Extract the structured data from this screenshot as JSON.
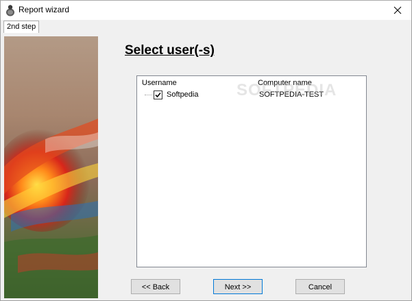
{
  "window": {
    "title": "Report wizard",
    "icon": "wizard-app-icon",
    "close_glyph": "✕"
  },
  "tabs": [
    {
      "label": "2nd step",
      "active": true
    }
  ],
  "main": {
    "heading": "Select user(-s)",
    "columns": [
      "Username",
      "Computer name"
    ],
    "rows": [
      {
        "username": "Softpedia",
        "computer": "SOFTPEDIA-TEST",
        "checked": true
      }
    ],
    "watermark": "SOFTPEDIA"
  },
  "buttons": {
    "back": "<< Back",
    "next": "Next >>",
    "cancel": "Cancel"
  },
  "colors": {
    "accent_border": "#0078d7",
    "window_bg": "#f0f0f0"
  }
}
